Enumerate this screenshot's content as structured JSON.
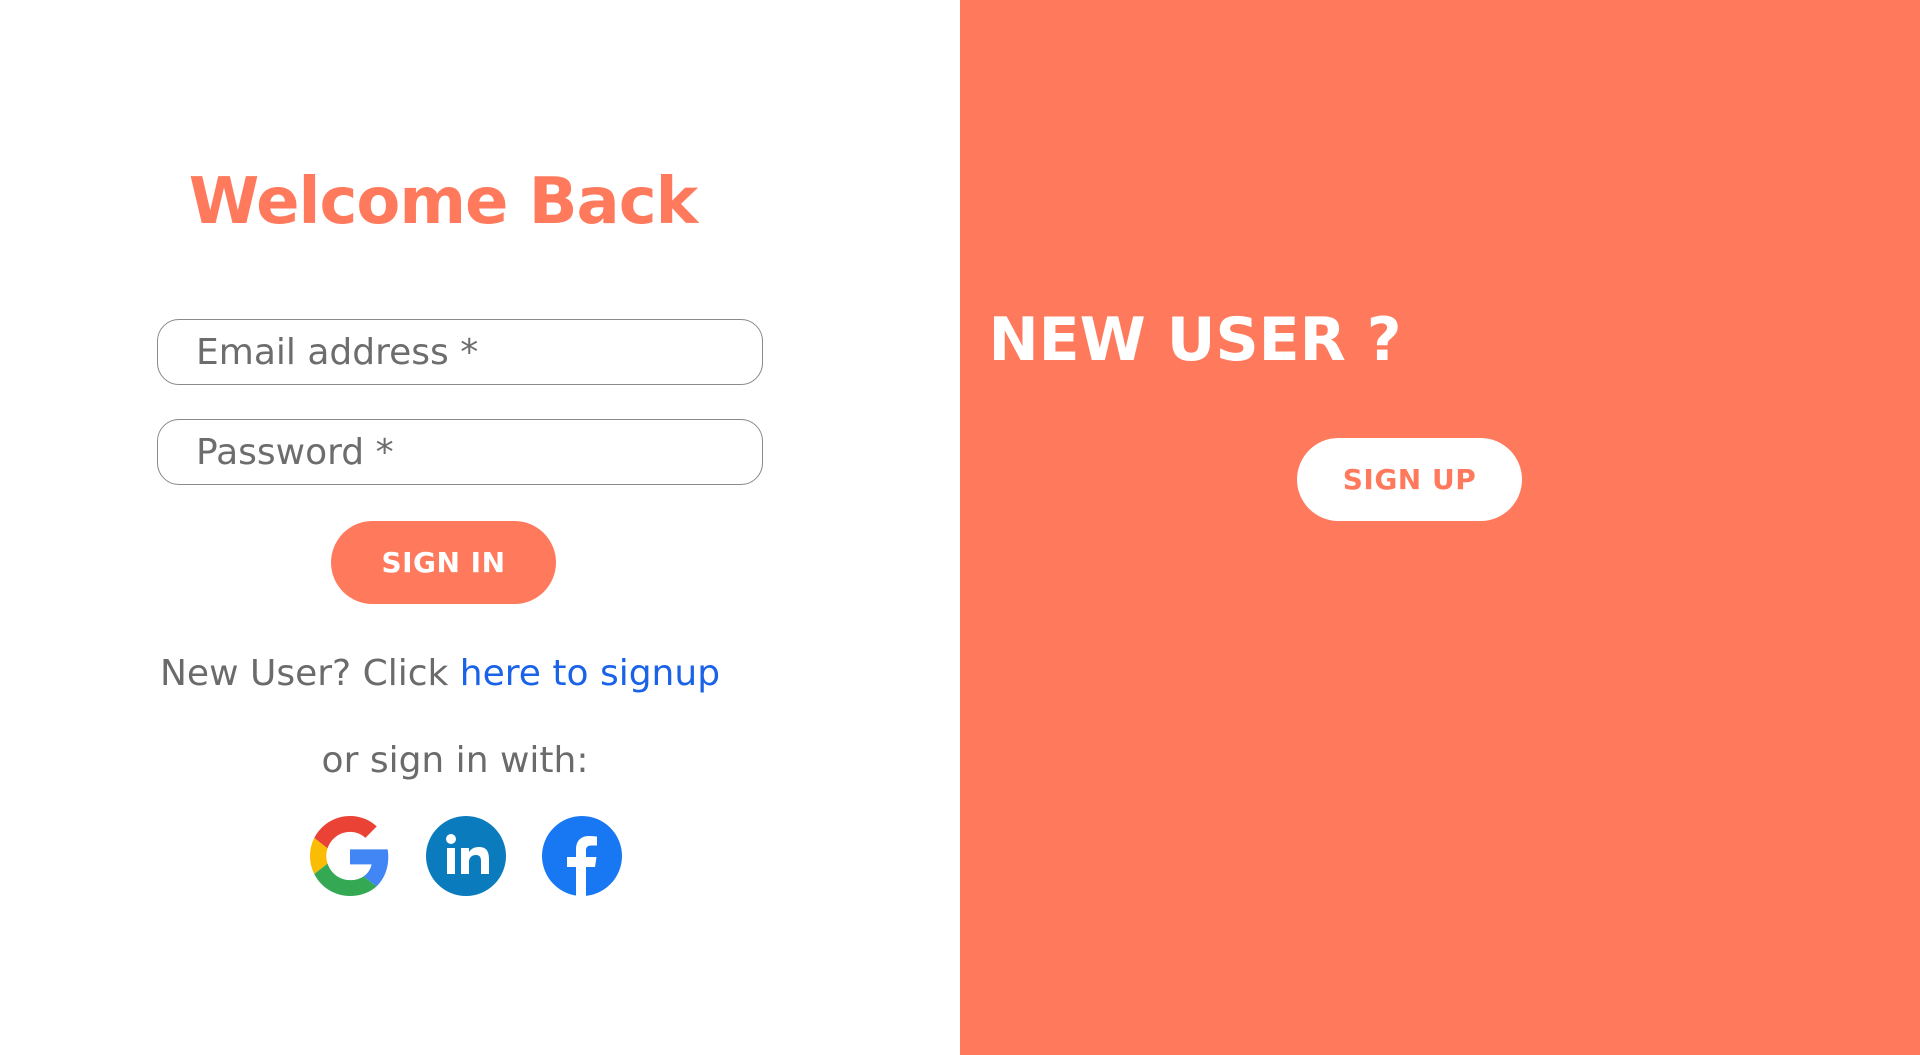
{
  "login": {
    "title": "Welcome Back",
    "email_placeholder": "Email address *",
    "password_placeholder": "Password *",
    "signin_label": "SIGN IN",
    "signup_prompt_text": "New User? Click ",
    "signup_link_text": "here to signup",
    "or_text": "or sign in with:",
    "socials": [
      {
        "name": "google",
        "icon": "google-icon"
      },
      {
        "name": "linkedin",
        "icon": "linkedin-icon"
      },
      {
        "name": "facebook",
        "icon": "facebook-icon"
      }
    ]
  },
  "signup_panel": {
    "title": "NEW USER ?",
    "signup_label": "SIGN UP"
  },
  "colors": {
    "accent": "#ff7a5c",
    "link": "#1a63e8",
    "text_gray": "#6b6b6b",
    "linkedin": "#0a7bbd",
    "facebook": "#1877f2"
  }
}
